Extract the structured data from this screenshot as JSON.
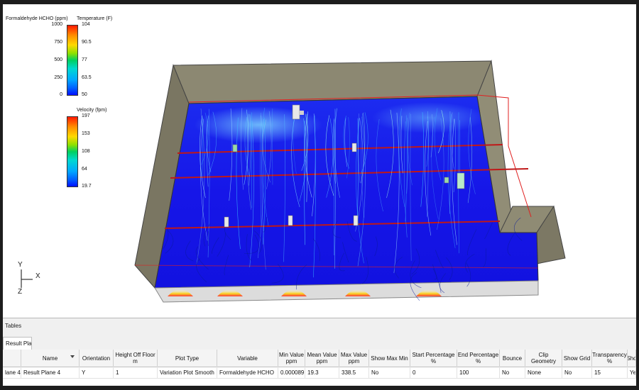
{
  "legend_top": {
    "title_left": "Formaldehyde HCHO (ppm)",
    "title_right": "Temperature (F)",
    "left_ticks": [
      "1000",
      "750",
      "500",
      "250",
      "0"
    ],
    "right_ticks": [
      "104",
      "90.5",
      "77",
      "63.5",
      "50"
    ]
  },
  "legend_velocity": {
    "title": "Velocity (fpm)",
    "ticks": [
      "197",
      "153",
      "108",
      "64",
      "19.7"
    ]
  },
  "axes": {
    "y": "Y",
    "x": "X",
    "z": "Z"
  },
  "tables_panel": {
    "title": "Tables",
    "tab": "Result Plane",
    "columns": [
      "",
      "Name",
      "Orientation",
      "Height Off Floor m",
      "Plot Type",
      "Variable",
      "Min Value ppm",
      "Mean Value ppm",
      "Max Value ppm",
      "Show Max Min",
      "Start Percentage %",
      "End Percentage %",
      "Bounce",
      "Clip Geometry",
      "Show Grid",
      "Transparency %",
      "Sho"
    ],
    "rows": [
      [
        "lane 4",
        "Result Plane 4",
        "Y",
        "1",
        "Variation Plot Smooth",
        "Formaldehyde HCHO",
        "0.000089",
        "19.3",
        "338.5",
        "No",
        "0",
        "100",
        "No",
        "None",
        "No",
        "15",
        "Yes"
      ]
    ]
  },
  "colors": {
    "floor": "#1414e6",
    "wall": "#8a8670",
    "outline": "#e02020",
    "panel_bg": "#f0f0f0"
  }
}
